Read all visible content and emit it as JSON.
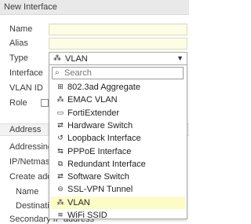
{
  "header": {
    "title": "New Interface"
  },
  "form": {
    "name_label": "Name",
    "alias_label": "Alias",
    "type_label": "Type",
    "interface_label": "Interface",
    "vlanid_label": "VLAN ID",
    "role_label": "Role",
    "role_info_icon": "info-icon"
  },
  "type_select": {
    "value": "VLAN",
    "icon": "vlan-icon",
    "caret": "▼"
  },
  "address_section": {
    "title": "Address",
    "addressing_label": "Addressing",
    "ipnetmask_label": "IP/Netmask",
    "create_label": "Create addr",
    "name_label": "Name",
    "destination_label": "Destinatio",
    "secondary_label": "Secondary IP address"
  },
  "dropdown": {
    "search_placeholder": "Search",
    "search_value": "",
    "options": [
      {
        "label": "802.3ad Aggregate",
        "icon": "aggregate-icon",
        "glyph": "⊞"
      },
      {
        "label": "EMAC VLAN",
        "icon": "vlan-icon",
        "glyph": "⁂"
      },
      {
        "label": "FortiExtender",
        "icon": "extender-icon",
        "glyph": "▭"
      },
      {
        "label": "Hardware Switch",
        "icon": "switch-icon",
        "glyph": "⇄"
      },
      {
        "label": "Loopback Interface",
        "icon": "loopback-icon",
        "glyph": "↺"
      },
      {
        "label": "PPPoE Interface",
        "icon": "pppoe-icon",
        "glyph": "⇆"
      },
      {
        "label": "Redundant Interface",
        "icon": "redundant-icon",
        "glyph": "⧉"
      },
      {
        "label": "Software Switch",
        "icon": "switch-icon",
        "glyph": "⇄"
      },
      {
        "label": "SSL-VPN Tunnel",
        "icon": "tunnel-icon",
        "glyph": "⊖"
      },
      {
        "label": "VLAN",
        "icon": "vlan-icon",
        "glyph": "⁂",
        "selected": true
      },
      {
        "label": "WiFi SSID",
        "icon": "wifi-icon",
        "glyph": "≋"
      }
    ]
  },
  "colors": {
    "highlight": "#fcfcc6",
    "field_bg": "#fdfde6",
    "header_bg": "#e9e9e9"
  }
}
